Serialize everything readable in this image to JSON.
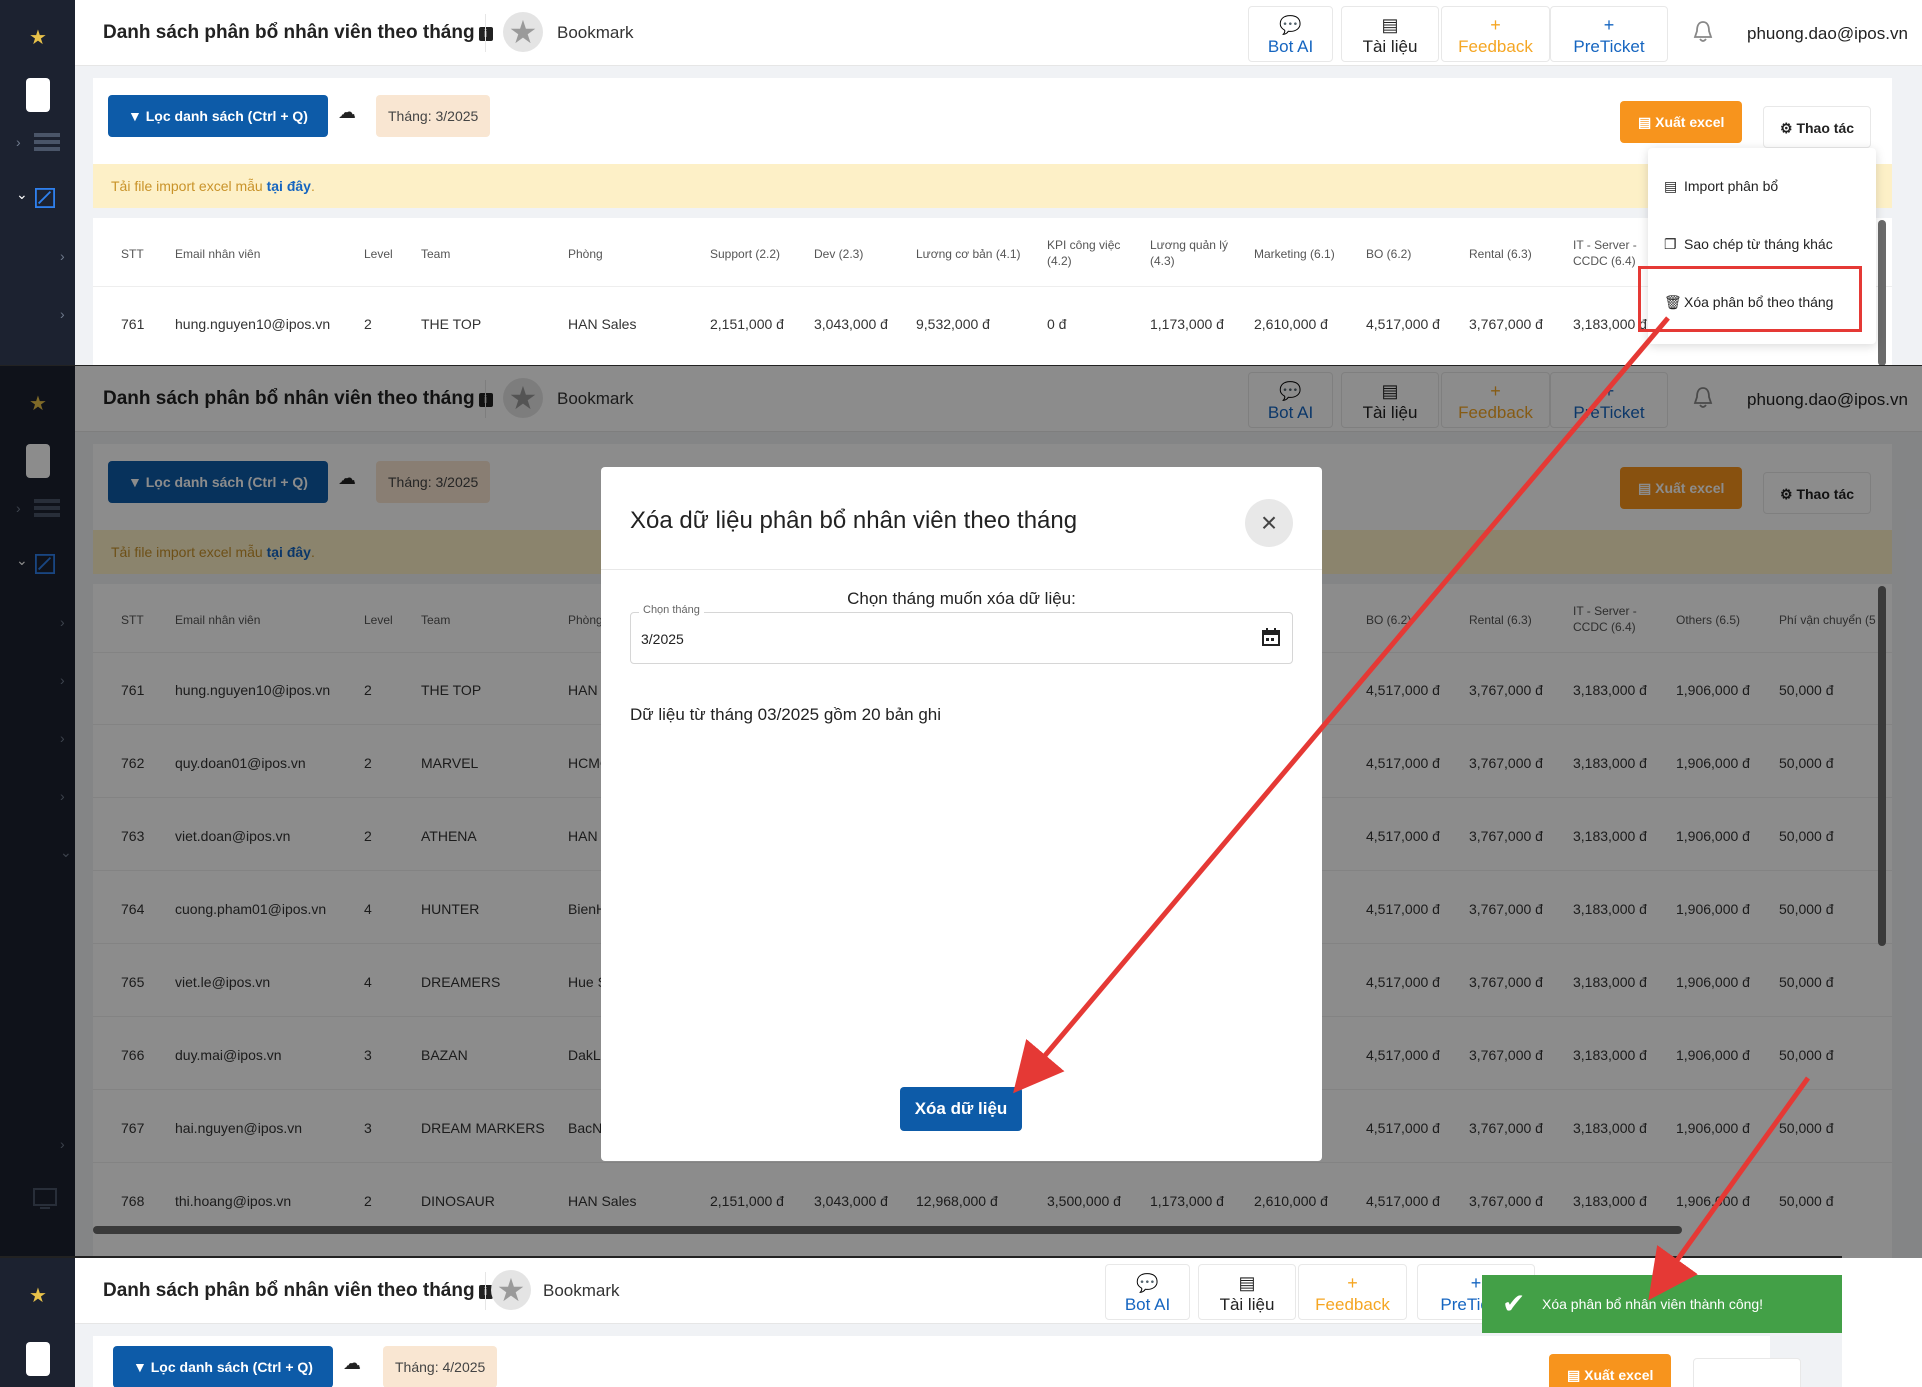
{
  "app": {
    "title": "Danh sách phân bổ nhân viên theo tháng",
    "bookmark": "Bookmark",
    "nav": [
      {
        "label": "Bot AI",
        "icon": "chat-icon"
      },
      {
        "label": "Tài liệu",
        "icon": "document-icon"
      },
      {
        "label": "Feedback",
        "icon": "plus-icon"
      },
      {
        "label": "PreTicket",
        "icon": "plus-icon"
      }
    ],
    "user": "phuong.dao@ipos.vn"
  },
  "toolbar": {
    "filter_label": "Lọc danh sách (Ctrl + Q)",
    "month_chip": "Tháng: 3/2025",
    "month_chip_after": "Tháng: 4/2025",
    "export_label": "Xuất excel",
    "action_label": "Thao tác"
  },
  "notice": {
    "text": "Tải file import excel mẫu ",
    "link": "tại đây",
    "suffix": "."
  },
  "dropdown": {
    "items": [
      "Import phân bổ",
      "Sao chép từ tháng khác",
      "Xóa phân bổ theo tháng"
    ]
  },
  "table": {
    "headers": [
      "STT",
      "Email nhân viên",
      "Level",
      "Team",
      "Phòng",
      "Support (2.2)",
      "Dev (2.3)",
      "Lương cơ bản (4.1)",
      "KPI công việc (4.2)",
      "Lương quản lý (4.3)",
      "Marketing (6.1)",
      "BO (6.2)",
      "Rental (6.3)",
      "IT - Server - CCDC (6.4)",
      "Others (6.5)",
      "Phí vận chuyển (5"
    ],
    "rows": [
      {
        "stt": "761",
        "email": "hung.nguyen10@ipos.vn",
        "level": "2",
        "team": "THE TOP",
        "phong": "HAN Sales",
        "support": "2,151,000 đ",
        "dev": "3,043,000 đ",
        "luong": "9,532,000 đ",
        "kpi": "0 đ",
        "ql": "1,173,000 đ",
        "mkt": "2,610,000 đ",
        "bo": "4,517,000 đ",
        "rental": "3,767,000 đ",
        "it": "3,183,000 đ",
        "others": "1,906,000 đ",
        "ship": "50,000 đ"
      },
      {
        "stt": "762",
        "email": "quy.doan01@ipos.vn",
        "level": "2",
        "team": "MARVEL",
        "phong": "HCMC",
        "bo": "4,517,000 đ",
        "rental": "3,767,000 đ",
        "it": "3,183,000 đ",
        "others": "1,906,000 đ",
        "ship": "50,000 đ"
      },
      {
        "stt": "763",
        "email": "viet.doan@ipos.vn",
        "level": "2",
        "team": "ATHENA",
        "phong": "HAN",
        "bo": "4,517,000 đ",
        "rental": "3,767,000 đ",
        "it": "3,183,000 đ",
        "others": "1,906,000 đ",
        "ship": "50,000 đ"
      },
      {
        "stt": "764",
        "email": "cuong.pham01@ipos.vn",
        "level": "4",
        "team": "HUNTER",
        "phong": "BienH",
        "bo": "4,517,000 đ",
        "rental": "3,767,000 đ",
        "it": "3,183,000 đ",
        "others": "1,906,000 đ",
        "ship": "50,000 đ"
      },
      {
        "stt": "765",
        "email": "viet.le@ipos.vn",
        "level": "4",
        "team": "DREAMERS",
        "phong": "Hue S",
        "bo": "4,517,000 đ",
        "rental": "3,767,000 đ",
        "it": "3,183,000 đ",
        "others": "1,906,000 đ",
        "ship": "50,000 đ"
      },
      {
        "stt": "766",
        "email": "duy.mai@ipos.vn",
        "level": "3",
        "team": "BAZAN",
        "phong": "DakLa",
        "bo": "4,517,000 đ",
        "rental": "3,767,000 đ",
        "it": "3,183,000 đ",
        "others": "1,906,000 đ",
        "ship": "50,000 đ"
      },
      {
        "stt": "767",
        "email": "hai.nguyen@ipos.vn",
        "level": "3",
        "team": "DREAM MARKERS",
        "phong": "BacN",
        "bo": "4,517,000 đ",
        "rental": "3,767,000 đ",
        "it": "3,183,000 đ",
        "others": "1,906,000 đ",
        "ship": "50,000 đ"
      },
      {
        "stt": "768",
        "email": "thi.hoang@ipos.vn",
        "level": "2",
        "team": "DINOSAUR",
        "phong": "HAN Sales",
        "support": "2,151,000 đ",
        "dev": "3,043,000 đ",
        "luong": "12,968,000 đ",
        "kpi": "3,500,000 đ",
        "ql": "1,173,000 đ",
        "mkt": "2,610,000 đ",
        "bo": "4,517,000 đ",
        "rental": "3,767,000 đ",
        "it": "3,183,000 đ",
        "others": "1,906,000 đ",
        "ship": "50,000 đ"
      }
    ]
  },
  "modal": {
    "title": "Xóa dữ liệu phân bổ nhân viên theo tháng",
    "prompt": "Chọn tháng muốn xóa dữ liệu:",
    "field_label": "Chọn tháng",
    "field_value": "3/2025",
    "info": "Dữ liệu từ tháng 03/2025 gồm 20 bản ghi",
    "submit": "Xóa dữ liệu"
  },
  "toast": {
    "text": "Xóa phân bổ nhân viên thành công!"
  },
  "colors": {
    "primary": "#0d5ba8",
    "export": "#f7941d",
    "success": "#43a047",
    "annotation": "#e53935",
    "sidebar": "#1c2230"
  }
}
